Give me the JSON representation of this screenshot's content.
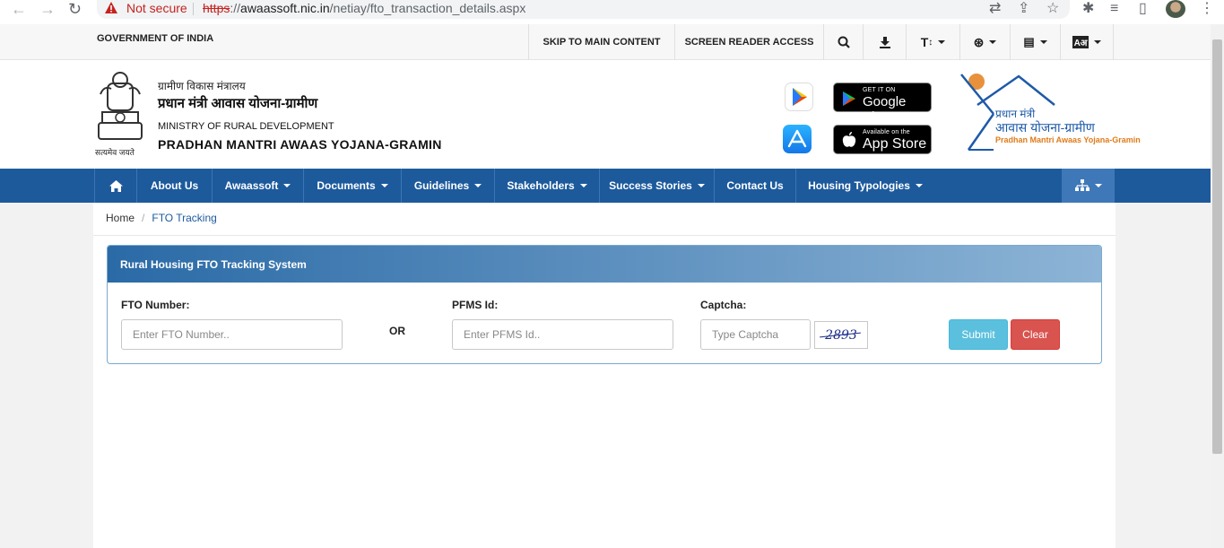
{
  "browser": {
    "not_secure": "Not secure",
    "url_scheme": "https",
    "url_rest_prefix": "://",
    "url_host": "awaassoft.nic.in",
    "url_path": "/netiay/fto_transaction_details.aspx"
  },
  "topbar": {
    "gov": "GOVERNMENT OF INDIA",
    "skip": "SKIP TO MAIN CONTENT",
    "screen_reader": "SCREEN READER ACCESS",
    "text_size": "T",
    "lang_sign": "Aअ"
  },
  "header": {
    "hindi_ministry": "ग्रामीण विकास मंत्रालय",
    "hindi_scheme": "प्रधान मंत्री आवास योजना-ग्रामीण",
    "ministry": "MINISTRY OF RURAL DEVELOPMENT",
    "scheme": "PRADHAN MANTRI AWAAS YOJANA-GRAMIN",
    "emblem_motto": "सत्यमेव जयते",
    "google_small": "GET IT ON",
    "google_big": "Google Play",
    "apple_small": "Available on the",
    "apple_big": "App Store",
    "pmay_logo_line1": "प्रधान मंत्री",
    "pmay_logo_line2": "आवास योजना-ग्रामीण",
    "pmay_logo_line3": "Pradhan Mantri Awaas Yojana-Gramin"
  },
  "nav": {
    "items": [
      {
        "label": "About Us"
      },
      {
        "label": "Awaassoft"
      },
      {
        "label": "Documents"
      },
      {
        "label": "Guidelines"
      },
      {
        "label": "Stakeholders"
      },
      {
        "label": "Success Stories"
      },
      {
        "label": "Contact Us"
      },
      {
        "label": "Housing Typologies"
      }
    ]
  },
  "breadcrumb": {
    "home": "Home",
    "separator": "/",
    "current": "FTO Tracking"
  },
  "form": {
    "title": "Rural Housing FTO Tracking System",
    "fto_label": "FTO Number:",
    "fto_placeholder": "Enter FTO Number..",
    "or": "OR",
    "pfms_label": "PFMS Id:",
    "pfms_placeholder": "Enter PFMS Id..",
    "captcha_label": "Captcha:",
    "captcha_placeholder": "Type Captcha",
    "captcha_code": "2893",
    "submit": "Submit",
    "clear": "Clear"
  },
  "colors": {
    "nav_blue": "#1d5a9c",
    "submit": "#5bc0de",
    "clear": "#d9534f"
  }
}
